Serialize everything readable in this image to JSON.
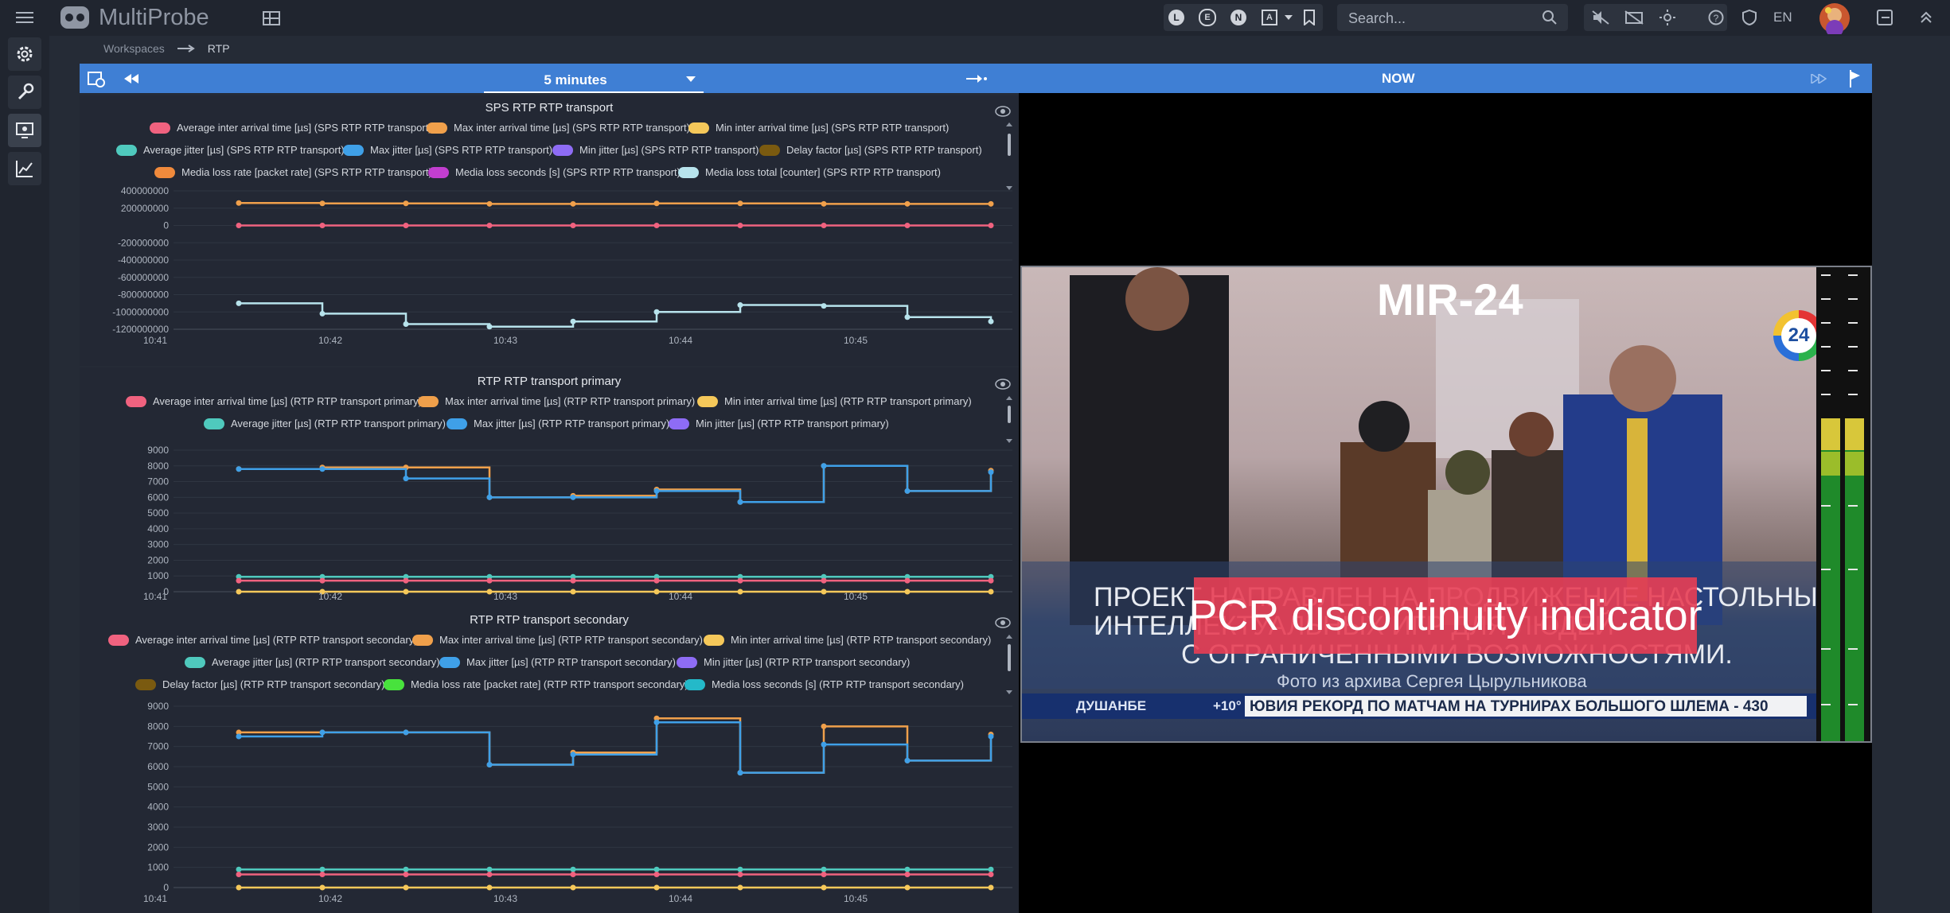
{
  "app": {
    "name": "MultiProbe",
    "search_placeholder": "Search...",
    "lang": "EN",
    "filters": [
      "L",
      "E",
      "N",
      "A"
    ]
  },
  "breadcrumb": {
    "root": "Workspaces",
    "current": "RTP"
  },
  "timebar": {
    "range": "5 minutes",
    "now_label": "NOW"
  },
  "colors": {
    "red": "#f0627f",
    "orange": "#f0a04b",
    "yellow": "#f5c85a",
    "teal": "#4fc9bd",
    "blue": "#3fa0e8",
    "purple": "#8e6cf5",
    "brown": "#7a5a10",
    "mediaorange": "#f08a3c",
    "magenta": "#c23ecf",
    "lightblue": "#b7e3ec",
    "green": "#48e23d",
    "cyan": "#24b9c9",
    "crimson": "#c0254f"
  },
  "charts": [
    {
      "title": "SPS RTP RTP transport",
      "legend": [
        {
          "label": "Average inter arrival time [µs] (SPS RTP RTP transport)",
          "color": "red"
        },
        {
          "label": "Max inter arrival time [µs] (SPS RTP RTP transport)",
          "color": "orange"
        },
        {
          "label": "Min inter arrival time [µs] (SPS RTP RTP transport)",
          "color": "yellow"
        },
        {
          "label": "Average jitter [µs] (SPS RTP RTP transport)",
          "color": "teal"
        },
        {
          "label": "Max jitter [µs] (SPS RTP RTP transport)",
          "color": "blue"
        },
        {
          "label": "Min jitter [µs] (SPS RTP RTP transport)",
          "color": "purple"
        },
        {
          "label": "Delay factor [µs] (SPS RTP RTP transport)",
          "color": "brown"
        },
        {
          "label": "Media loss rate [packet rate] (SPS RTP RTP transport)",
          "color": "mediaorange"
        },
        {
          "label": "Media loss seconds [s] (SPS RTP RTP transport)",
          "color": "magenta"
        },
        {
          "label": "Media loss total [counter] (SPS RTP RTP transport)",
          "color": "lightblue"
        }
      ],
      "y_ticks": [
        "400000000",
        "200000000",
        "0",
        "-200000000",
        "-400000000",
        "-600000000",
        "-800000000",
        "-1000000000",
        "-1200000000"
      ],
      "x_ticks": [
        "10:41",
        "10:42",
        "10:43",
        "10:44",
        "10:45"
      ]
    },
    {
      "title": "RTP RTP transport primary",
      "legend": [
        {
          "label": "Average inter arrival time [µs] (RTP RTP transport primary)",
          "color": "red"
        },
        {
          "label": "Max inter arrival time [µs] (RTP RTP transport primary)",
          "color": "orange"
        },
        {
          "label": "Min inter arrival time [µs] (RTP RTP transport primary)",
          "color": "yellow"
        },
        {
          "label": "Average jitter [µs] (RTP RTP transport primary)",
          "color": "teal"
        },
        {
          "label": "Max jitter [µs] (RTP RTP transport primary)",
          "color": "blue"
        },
        {
          "label": "Min jitter [µs] (RTP RTP transport primary)",
          "color": "purple"
        }
      ],
      "y_ticks": [
        "9000",
        "8000",
        "7000",
        "6000",
        "5000",
        "4000",
        "3000",
        "2000",
        "1000",
        "0"
      ],
      "x_ticks": [
        "10:41",
        "10:42",
        "10:43",
        "10:44",
        "10:45"
      ]
    },
    {
      "title": "RTP RTP transport secondary",
      "legend": [
        {
          "label": "Average inter arrival time [µs] (RTP RTP transport secondary)",
          "color": "red"
        },
        {
          "label": "Max inter arrival time [µs] (RTP RTP transport secondary)",
          "color": "orange"
        },
        {
          "label": "Min inter arrival time [µs] (RTP RTP transport secondary)",
          "color": "yellow"
        },
        {
          "label": "Average jitter [µs] (RTP RTP transport secondary)",
          "color": "teal"
        },
        {
          "label": "Max jitter [µs] (RTP RTP transport secondary)",
          "color": "blue"
        },
        {
          "label": "Min jitter [µs] (RTP RTP transport secondary)",
          "color": "purple"
        },
        {
          "label": "Delay factor [µs] (RTP RTP transport secondary)",
          "color": "brown"
        },
        {
          "label": "Media loss rate [packet rate] (RTP RTP transport secondary)",
          "color": "green"
        },
        {
          "label": "Media loss seconds [s] (RTP RTP transport secondary)",
          "color": "cyan"
        }
      ],
      "y_ticks": [
        "9000",
        "8000",
        "7000",
        "6000",
        "5000",
        "4000",
        "3000",
        "2000",
        "1000",
        "0"
      ],
      "x_ticks": [
        "10:41",
        "10:42",
        "10:43",
        "10:44",
        "10:45"
      ]
    }
  ],
  "chart_data": [
    {
      "type": "line",
      "title": "SPS RTP RTP transport",
      "ylim": [
        -1200000000,
        400000000
      ],
      "x": [
        "10:41:15",
        "10:41:45",
        "10:42:15",
        "10:42:45",
        "10:43:15",
        "10:43:45",
        "10:44:15",
        "10:44:45",
        "10:45:15",
        "10:45:45"
      ],
      "series": [
        {
          "name": "Max inter arrival time [µs] (SPS RTP RTP transport)",
          "color": "orange",
          "values": [
            260000000,
            255000000,
            255000000,
            250000000,
            250000000,
            255000000,
            255000000,
            250000000,
            250000000,
            250000000
          ]
        },
        {
          "name": "Average inter arrival time [µs] (SPS RTP RTP transport)",
          "color": "red",
          "values": [
            0,
            0,
            0,
            0,
            0,
            0,
            0,
            0,
            0,
            0
          ]
        },
        {
          "name": "Media loss total [counter] (SPS RTP RTP transport)",
          "color": "lightblue",
          "values": [
            -900000000,
            -1020000000,
            -1140000000,
            -1170000000,
            -1110000000,
            -1000000000,
            -920000000,
            -930000000,
            -1060000000,
            -1110000000
          ]
        }
      ]
    },
    {
      "type": "line",
      "title": "RTP RTP transport primary",
      "ylim": [
        0,
        9000
      ],
      "x": [
        "10:41:15",
        "10:41:45",
        "10:42:15",
        "10:42:45",
        "10:43:15",
        "10:43:45",
        "10:44:15",
        "10:44:45",
        "10:45:15",
        "10:45:45"
      ],
      "series": [
        {
          "name": "Max inter arrival time [µs] (RTP RTP transport primary)",
          "color": "orange",
          "values": [
            7800,
            7900,
            7900,
            6000,
            6100,
            6500,
            5700,
            8000,
            6400,
            7700
          ]
        },
        {
          "name": "Max jitter [µs] (RTP RTP transport primary)",
          "color": "blue",
          "values": [
            7800,
            7800,
            7200,
            6000,
            6000,
            6400,
            5700,
            8000,
            6400,
            7600
          ]
        },
        {
          "name": "Average jitter [µs] (RTP RTP transport primary)",
          "color": "teal",
          "values": [
            950,
            950,
            950,
            950,
            950,
            950,
            950,
            950,
            950,
            950
          ]
        },
        {
          "name": "Average inter arrival time [µs] (RTP RTP transport primary)",
          "color": "red",
          "values": [
            700,
            700,
            700,
            700,
            700,
            700,
            700,
            700,
            700,
            700
          ]
        },
        {
          "name": "Min inter arrival time [µs] (RTP RTP transport primary)",
          "color": "yellow",
          "values": [
            0,
            0,
            0,
            0,
            0,
            0,
            0,
            0,
            0,
            0
          ]
        }
      ]
    },
    {
      "type": "line",
      "title": "RTP RTP transport secondary",
      "ylim": [
        0,
        9000
      ],
      "x": [
        "10:41:15",
        "10:41:45",
        "10:42:15",
        "10:42:45",
        "10:43:15",
        "10:43:45",
        "10:44:15",
        "10:44:45",
        "10:45:15",
        "10:45:45"
      ],
      "series": [
        {
          "name": "Max inter arrival time [µs] (RTP RTP transport secondary)",
          "color": "orange",
          "values": [
            7700,
            7700,
            7700,
            6100,
            6700,
            8400,
            5700,
            8000,
            6300,
            7600
          ]
        },
        {
          "name": "Max jitter [µs] (RTP RTP transport secondary)",
          "color": "blue",
          "values": [
            7500,
            7700,
            7700,
            6100,
            6600,
            8200,
            5700,
            7100,
            6300,
            7500
          ]
        },
        {
          "name": "Average jitter [µs] (RTP RTP transport secondary)",
          "color": "teal",
          "values": [
            900,
            900,
            900,
            900,
            900,
            900,
            900,
            900,
            900,
            900
          ]
        },
        {
          "name": "Average inter arrival time [µs] (RTP RTP transport secondary)",
          "color": "red",
          "values": [
            650,
            650,
            650,
            650,
            650,
            650,
            650,
            650,
            650,
            650
          ]
        },
        {
          "name": "Min inter arrival time [µs] (RTP RTP transport secondary)",
          "color": "yellow",
          "values": [
            0,
            0,
            0,
            0,
            0,
            0,
            0,
            0,
            0,
            0
          ]
        }
      ]
    }
  ],
  "video": {
    "channel": "MIR-24",
    "alert": "PCR discontinuity indicator",
    "logo_number": "24",
    "subtitle_line1": "ПРОЕКТ НАПРАВЛЕН НА ПРОДВИЖЕНИЕ НАСТОЛЬНЫХ",
    "subtitle_line2": "ИНТЕЛЛЕКТУАЛЬНЫХ ИГР ДЛЯ ЛЮДЕЙ",
    "subtitle_line3": "С ОГРАНИЧЕННЫМИ ВОЗМОЖНОСТЯМИ.",
    "photo_credit": "Фото  из архива Сергея Цырульникова",
    "city": "ДУШАНБЕ",
    "temp": "+10°",
    "ticker": "ЮВИЯ РЕКОРД ПО МАТЧАМ НА ТУРНИРАХ БОЛЬШОГО ШЛЕМА - 430"
  }
}
